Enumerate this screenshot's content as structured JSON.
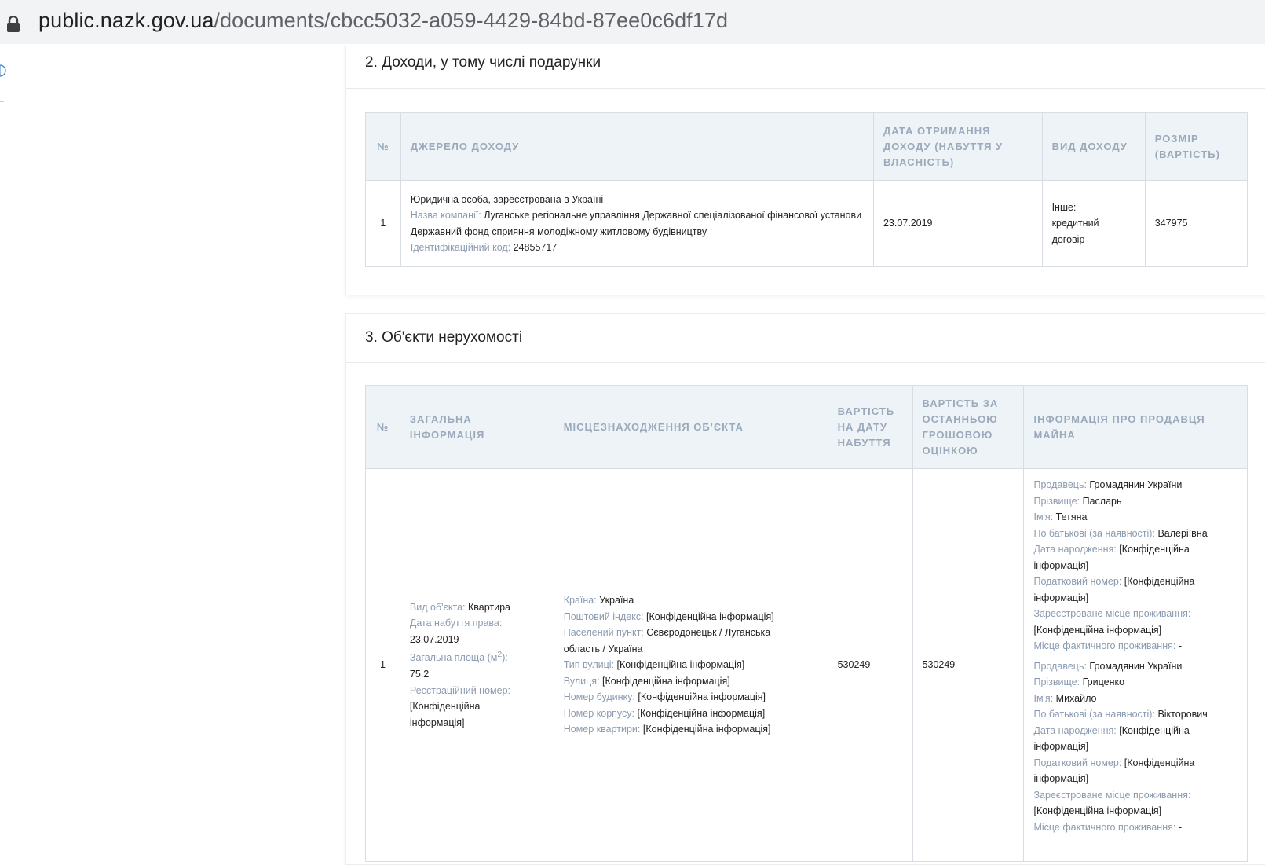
{
  "address_bar": {
    "url_host": "public.nazk.gov.ua",
    "url_path": "/documents/cbcc5032-a059-4429-84bd-87ee0c6df17d",
    "icon": "lock-icon"
  },
  "income_section": {
    "title": "2. Доходи, у тому числі подарунки",
    "headers": [
      "№",
      "ДЖЕРЕЛО ДОХОДУ",
      "ДАТА ОТРИМАННЯ ДОХОДУ (НАБУТТЯ У ВЛАСНІСТЬ)",
      "ВИД ДОХОДУ",
      "РОЗМІР (ВАРТІСТЬ)"
    ],
    "rows": [
      {
        "num": "1",
        "source_type": "Юридична особа, зареєстрована в Україні",
        "company_label": "Назва компанії:",
        "company_name": "Луганське регіональне управління Державної спеціалізованої фінансової установи Державний фонд сприяння молодіжному житловому будівництву",
        "code_label": "Ідентифікаційний код:",
        "code": "24855717",
        "date": "23.07.2019",
        "income_type": "Інше: кредитний договір",
        "amount": "347975"
      }
    ]
  },
  "property_section": {
    "title": "3. Об'єкти нерухомості",
    "headers": [
      "№",
      "ЗАГАЛЬНА ІНФОРМАЦІЯ",
      "МІСЦЕЗНАХОДЖЕННЯ ОБ'ЄКТА",
      "ВАРТІСТЬ НА ДАТУ НАБУТТЯ",
      "ВАРТІСТЬ ЗА ОСТАННЬОЮ ГРОШОВОЮ ОЦІНКОЮ",
      "ІНФОРМАЦІЯ ПРО ПРОДАВЦЯ МАЙНА"
    ],
    "rows": [
      {
        "num": "1",
        "general": {
          "type_label": "Вид об'єкта:",
          "type": "Квартира",
          "date_label": "Дата набуття права:",
          "date": "23.07.2019",
          "area_label": "Загальна площа (м",
          "area_sup": "2",
          "area_suffix": "):",
          "area": "75.2",
          "reg_label": "Реєстраційний номер:",
          "reg": "[Конфіденційна інформація]"
        },
        "location": {
          "country_label": "Країна:",
          "country": "Україна",
          "postal_label": "Поштовий індекс:",
          "postal": "[Конфіденційна інформація]",
          "city_label": "Населений пункт:",
          "city": "Сєвєродонецьк / Луганська область / Україна",
          "street_type_label": "Тип вулиці:",
          "street_type": "[Конфіденційна інформація]",
          "street_label": "Вулиця:",
          "street": "[Конфіденційна інформація]",
          "house_label": "Номер будинку:",
          "house": "[Конфіденційна інформація]",
          "building_label": "Номер корпусу:",
          "building": "[Конфіденційна інформація]",
          "apt_label": "Номер квартири:",
          "apt": "[Конфіденційна інформація]"
        },
        "value_acquired": "530249",
        "value_assessed": "530249",
        "sellers": [
          {
            "seller_label": "Продавець:",
            "seller": "Громадянин України",
            "surname_label": "Прізвище:",
            "surname": "Пасларь",
            "name_label": "Ім'я:",
            "name": "Тетяна",
            "patronymic_label": "По батькові (за наявності):",
            "patronymic": "Валеріївна",
            "birth_label": "Дата народження:",
            "birth": "[Конфіденційна інформація]",
            "tax_label": "Податковий номер:",
            "tax": "[Конфіденційна інформація]",
            "reg_place_label": "Зареєстроване місце проживання:",
            "reg_place": "[Конфіденційна інформація]",
            "actual_place_label": "Місце фактичного проживання:",
            "actual_place": "-"
          },
          {
            "seller_label": "Продавець:",
            "seller": "Громадянин України",
            "surname_label": "Прізвище:",
            "surname": "Гриценко",
            "name_label": "Ім'я:",
            "name": "Михайло",
            "patronymic_label": "По батькові (за наявності):",
            "patronymic": "Вікторович",
            "birth_label": "Дата народження:",
            "birth": "[Конфіденційна інформація]",
            "tax_label": "Податковий номер:",
            "tax": "[Конфіденційна інформація]",
            "reg_place_label": "Зареєстроване місце проживання:",
            "reg_place": "[Конфіденційна інформація]",
            "actual_place_label": "Місце фактичного проживання:",
            "actual_place": "-"
          }
        ]
      }
    ]
  }
}
